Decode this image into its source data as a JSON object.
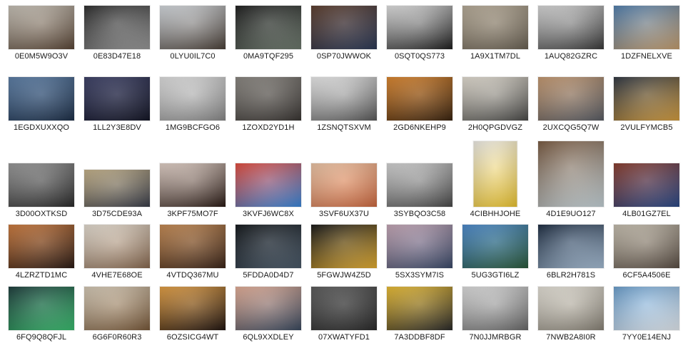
{
  "files": [
    {
      "name": "0E0M5W9O3V",
      "icon": "photo-thumbnail-icon",
      "colors": [
        "#c9c3b8",
        "#5a4636"
      ]
    },
    {
      "name": "0E83D47E18",
      "icon": "photo-thumbnail-icon",
      "colors": [
        "#2a2a2a",
        "#9a9a9a"
      ]
    },
    {
      "name": "0LYU0IL7C0",
      "icon": "photo-thumbnail-icon",
      "colors": [
        "#d8dde2",
        "#4a4038"
      ]
    },
    {
      "name": "0MA9TQF295",
      "icon": "photo-thumbnail-icon",
      "colors": [
        "#1c1c1c",
        "#6e7a6e"
      ]
    },
    {
      "name": "0SP70JWWOK",
      "icon": "photo-thumbnail-icon",
      "colors": [
        "#5b3b2a",
        "#2c3a58"
      ]
    },
    {
      "name": "0SQT0QS773",
      "icon": "photo-thumbnail-icon",
      "colors": [
        "#e6e6e6",
        "#1e1e1e"
      ]
    },
    {
      "name": "1A9X1TM7DL",
      "icon": "photo-thumbnail-icon",
      "colors": [
        "#b8ac98",
        "#6b6254"
      ]
    },
    {
      "name": "1AUQ82GZRC",
      "icon": "photo-thumbnail-icon",
      "colors": [
        "#dcdcdc",
        "#3a3a3a"
      ]
    },
    {
      "name": "1DZFNELXVE",
      "icon": "photo-thumbnail-icon",
      "colors": [
        "#4f7fb0",
        "#c8a070"
      ]
    },
    {
      "name": "1EGDXUXXQO",
      "icon": "photo-thumbnail-icon",
      "colors": [
        "#5a7ea8",
        "#1d2f48"
      ]
    },
    {
      "name": "1LL2Y3E8DV",
      "icon": "photo-thumbnail-icon",
      "colors": [
        "#3a3e66",
        "#141626"
      ]
    },
    {
      "name": "1MG9BCFGO6",
      "icon": "photo-thumbnail-icon",
      "colors": [
        "#e2e2e2",
        "#8a8a8a"
      ]
    },
    {
      "name": "1ZOXD2YD1H",
      "icon": "photo-thumbnail-icon",
      "colors": [
        "#8a8680",
        "#3a3633"
      ]
    },
    {
      "name": "1ZSNQTSXVM",
      "icon": "photo-thumbnail-icon",
      "colors": [
        "#f0f0f0",
        "#5a5a5a"
      ]
    },
    {
      "name": "2GD6NKEHP9",
      "icon": "photo-thumbnail-icon",
      "colors": [
        "#e0862a",
        "#3a2410"
      ]
    },
    {
      "name": "2H0QPGDVGZ",
      "icon": "photo-thumbnail-icon",
      "colors": [
        "#e8e2d6",
        "#4a4a48"
      ]
    },
    {
      "name": "2UXCQG5Q7W",
      "icon": "photo-thumbnail-icon",
      "colors": [
        "#c89a70",
        "#5a5e66"
      ]
    },
    {
      "name": "2VULFYMCB5",
      "icon": "photo-thumbnail-icon",
      "colors": [
        "#2c3440",
        "#d8a040"
      ]
    },
    {
      "name": "3D00OXTKSD",
      "icon": "photo-thumbnail-icon",
      "colors": [
        "#9a9a9a",
        "#2a2a2a"
      ]
    },
    {
      "name": "3D75CDE93A",
      "icon": "photo-thumbnail-icon",
      "colors": [
        "#c8b48a",
        "#3a3e4a"
      ]
    },
    {
      "name": "3KPF75MO7F",
      "icon": "photo-thumbnail-icon",
      "colors": [
        "#e8d6cc",
        "#2a1a14"
      ]
    },
    {
      "name": "3KVFJ6WC8X",
      "icon": "photo-thumbnail-icon",
      "colors": [
        "#e84a3a",
        "#3a8ae0"
      ]
    },
    {
      "name": "3SVF6UX37U",
      "icon": "photo-thumbnail-icon",
      "colors": [
        "#f0c8a8",
        "#d06a40"
      ]
    },
    {
      "name": "3SYBQO3C58",
      "icon": "photo-thumbnail-icon",
      "colors": [
        "#d8d8d8",
        "#4a4a4a"
      ]
    },
    {
      "name": "4CIBHHJOHE",
      "icon": "photo-thumbnail-icon",
      "colors": [
        "#f2f0ea",
        "#f0c830"
      ]
    },
    {
      "name": "4D1E9UO127",
      "icon": "photo-thumbnail-icon",
      "colors": [
        "#7a5a40",
        "#c8d6dc"
      ]
    },
    {
      "name": "4LB01GZ7EL",
      "icon": "photo-thumbnail-icon",
      "colors": [
        "#8a3a2a",
        "#2a4a8a"
      ]
    },
    {
      "name": "4LZRZTD1MC",
      "icon": "photo-thumbnail-icon",
      "colors": [
        "#d07a3a",
        "#2a1a14"
      ]
    },
    {
      "name": "4VHE7E68OE",
      "icon": "photo-thumbnail-icon",
      "colors": [
        "#e8e0d4",
        "#8a6a50"
      ]
    },
    {
      "name": "4VTDQ367MU",
      "icon": "photo-thumbnail-icon",
      "colors": [
        "#c88a50",
        "#3a2418"
      ]
    },
    {
      "name": "5FDDA0D4D7",
      "icon": "photo-thumbnail-icon",
      "colors": [
        "#101418",
        "#4a5a6a"
      ]
    },
    {
      "name": "5FGWJW4Z5D",
      "icon": "photo-thumbnail-icon",
      "colors": [
        "#141414",
        "#e8b030"
      ]
    },
    {
      "name": "5SX3SYM7IS",
      "icon": "photo-thumbnail-icon",
      "colors": [
        "#c8a8b8",
        "#3a4a6a"
      ]
    },
    {
      "name": "5UG3GTI6LZ",
      "icon": "photo-thumbnail-icon",
      "colors": [
        "#4a8ad0",
        "#2a5a3a"
      ]
    },
    {
      "name": "6BLR2H781S",
      "icon": "photo-thumbnail-icon",
      "colors": [
        "#1a2a40",
        "#a8c0d8"
      ]
    },
    {
      "name": "6CF5A4506E",
      "icon": "photo-thumbnail-icon",
      "colors": [
        "#c8c0b0",
        "#5a4e44"
      ]
    },
    {
      "name": "6FQ9Q8QFJL",
      "icon": "photo-thumbnail-icon",
      "colors": [
        "#1a3a3a",
        "#3ac070"
      ]
    },
    {
      "name": "6G6F0R60R3",
      "icon": "photo-thumbnail-icon",
      "colors": [
        "#d8ccb8",
        "#7a5a3a"
      ]
    },
    {
      "name": "6OZSICG4WT",
      "icon": "photo-thumbnail-icon",
      "colors": [
        "#e8a040",
        "#201410"
      ]
    },
    {
      "name": "6QL9XXDLEY",
      "icon": "photo-thumbnail-icon",
      "colors": [
        "#e8b098",
        "#3a4a60"
      ]
    },
    {
      "name": "07XWATYFD1",
      "icon": "photo-thumbnail-icon",
      "colors": [
        "#5a5a5a",
        "#2a2a2a"
      ]
    },
    {
      "name": "7A3DDBF8DF",
      "icon": "photo-thumbnail-icon",
      "colors": [
        "#f0c030",
        "#2a2a2a"
      ]
    },
    {
      "name": "7N0JJMRBGR",
      "icon": "photo-thumbnail-icon",
      "colors": [
        "#e0e0e0",
        "#6a6a6a"
      ]
    },
    {
      "name": "7NWB2A8I0R",
      "icon": "photo-thumbnail-icon",
      "colors": [
        "#e8e4da",
        "#8a8478"
      ]
    },
    {
      "name": "7YY0E14ENJ",
      "icon": "photo-thumbnail-icon",
      "colors": [
        "#6aa0d0",
        "#e8eef4"
      ]
    }
  ]
}
